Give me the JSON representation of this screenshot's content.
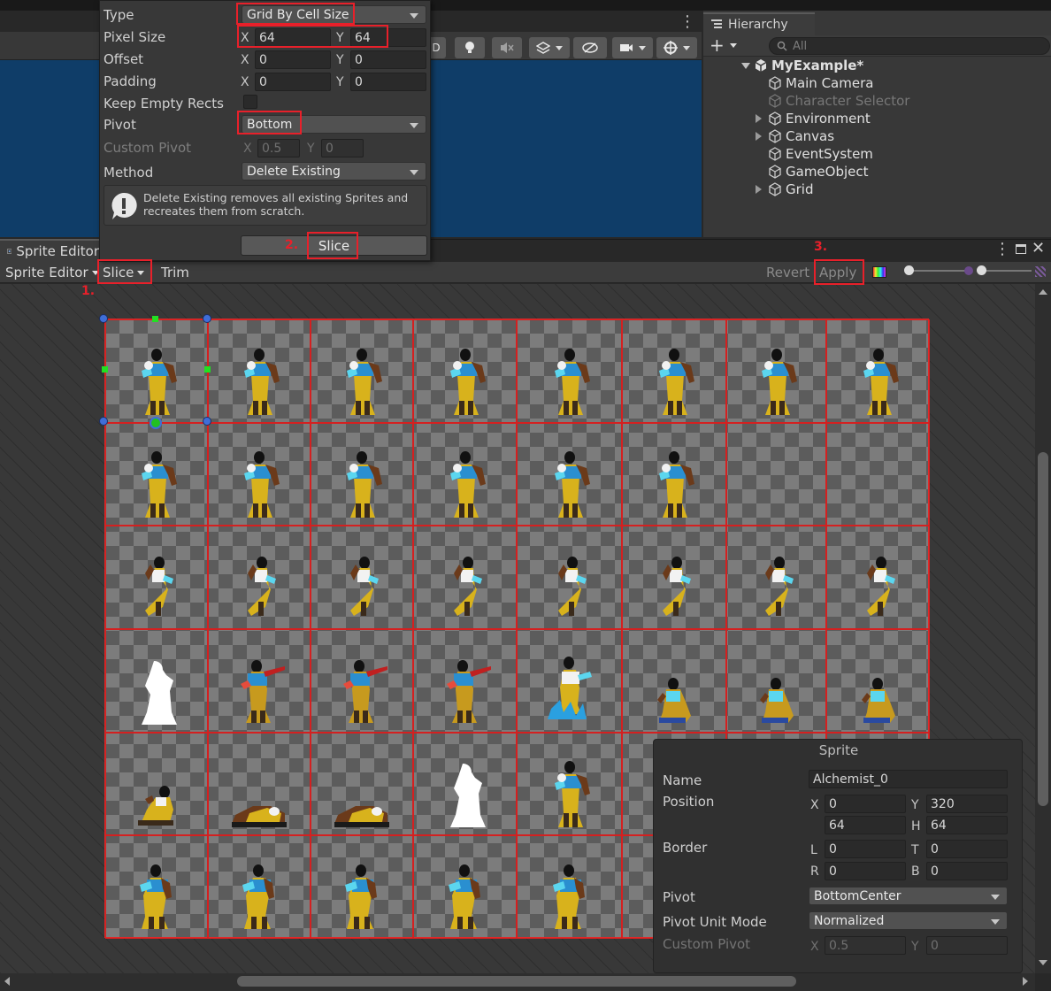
{
  "slice_popup": {
    "type": {
      "label": "Type",
      "value": "Grid By Cell Size"
    },
    "pixel_size": {
      "label": "Pixel Size",
      "x_label": "X",
      "x": "64",
      "y_label": "Y",
      "y": "64"
    },
    "offset": {
      "label": "Offset",
      "x_label": "X",
      "x": "0",
      "y_label": "Y",
      "y": "0"
    },
    "padding": {
      "label": "Padding",
      "x_label": "X",
      "x": "0",
      "y_label": "Y",
      "y": "0"
    },
    "keep_empty": {
      "label": "Keep Empty Rects",
      "checked": false
    },
    "pivot": {
      "label": "Pivot",
      "value": "Bottom"
    },
    "custom_pivot": {
      "label": "Custom Pivot",
      "x_label": "X",
      "x": "0.5",
      "y_label": "Y",
      "y": "0"
    },
    "method": {
      "label": "Method",
      "value": "Delete Existing"
    },
    "help_text": "Delete Existing removes all existing Sprites and recreates them from scratch.",
    "slice_button": "Slice"
  },
  "annotations": {
    "step1": "1.",
    "step2": "2.",
    "step3": "3."
  },
  "hierarchy": {
    "tab": "Hierarchy",
    "search_placeholder": "All",
    "scene": "MyExample*",
    "items": [
      {
        "label": "Main Camera",
        "expandable": false,
        "dim": false
      },
      {
        "label": "Character Selector",
        "expandable": false,
        "dim": true
      },
      {
        "label": "Environment",
        "expandable": true,
        "dim": false
      },
      {
        "label": "Canvas",
        "expandable": true,
        "dim": false
      },
      {
        "label": "EventSystem",
        "expandable": false,
        "dim": false
      },
      {
        "label": "GameObject",
        "expandable": false,
        "dim": false
      },
      {
        "label": "Grid",
        "expandable": true,
        "dim": false
      }
    ]
  },
  "sprite_editor": {
    "tab_title": "Sprite Editor",
    "mode_dropdown": "Sprite Editor",
    "slice": "Slice",
    "trim": "Trim",
    "revert": "Revert",
    "apply": "Apply"
  },
  "sprite_panel": {
    "title": "Sprite",
    "name_label": "Name",
    "name": "Alchemist_0",
    "position_label": "Position",
    "x_label": "X",
    "x": "0",
    "y_label": "Y",
    "y": "320",
    "w": "64",
    "h_label": "H",
    "h": "64",
    "border_label": "Border",
    "l_label": "L",
    "l": "0",
    "t_label": "T",
    "t": "0",
    "r_label": "R",
    "r": "0",
    "b_label": "B",
    "b": "0",
    "pivot_label": "Pivot",
    "pivot": "BottomCenter",
    "pivot_unit_label": "Pivot Unit Mode",
    "pivot_unit": "Normalized",
    "custom_pivot_label": "Custom Pivot",
    "cp_x_label": "X",
    "cp_x": "0.5",
    "cp_y_label": "Y",
    "cp_y": "0"
  },
  "sheet": {
    "rows": [
      [
        "idle",
        "idle",
        "idle",
        "idle",
        "idle",
        "idle",
        "idle",
        "idle"
      ],
      [
        "idle",
        "idle",
        "idle",
        "idle",
        "idle",
        "idle",
        "empty",
        "empty"
      ],
      [
        "run",
        "run",
        "run",
        "run",
        "run",
        "run",
        "run",
        "run"
      ],
      [
        "silhouette",
        "attack",
        "attack",
        "attack",
        "cast",
        "crouch",
        "crouch",
        "crouch"
      ],
      [
        "down",
        "lying",
        "lying",
        "silhouette",
        "idle",
        "idle",
        "hidden",
        "hidden"
      ],
      [
        "walk",
        "walk",
        "walk",
        "walk",
        "walk",
        "walk",
        "hidden",
        "hidden"
      ]
    ]
  },
  "colors": {
    "highlight": "#e8202a",
    "handle": "#3f6ed8",
    "scene_bg": "#0f3d68"
  }
}
